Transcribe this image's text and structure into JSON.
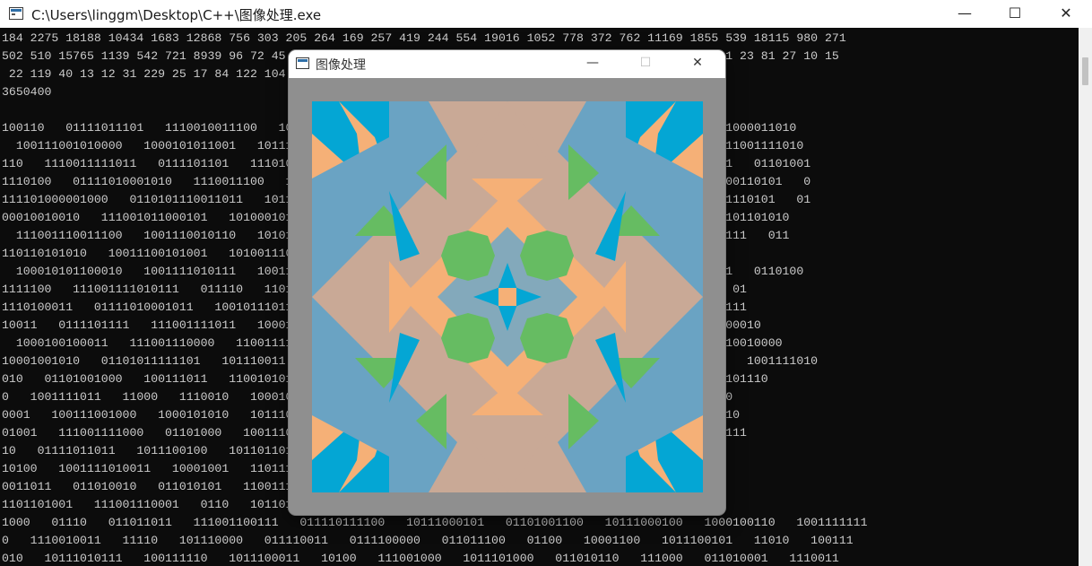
{
  "console": {
    "title": "C:\\Users\\linggm\\Desktop\\C++\\图像处理.exe",
    "controls": {
      "minimize": "—",
      "maximize": "☐",
      "close": "✕"
    },
    "lines": [
      "184 2275 18188 10434 1683 12868 756 303 205 264 169 257 419 244 554 19016 1052 778 372 762 11169 1855 539 18115 980 271",
      "502 510 15765 1139 542 721 8939 96 72 45 23 12 12 10 11 9 13 14 25 19 29 43 76 34 92 12 14 18 9 11 9 11 23 81 27 10 15",
      " 22 119 40 13 12 31 229 25 17 84 122 104 130 109 126 104 132 175 100 137 159 50 3740 903",
      "3650400",
      "",
      "100110   01111011101   1110010011100   1011101100   110010110011   101110000   0110101111110010   01101000011010",
      "  100111001010000   1000101011001   10111001   1110101011011   10011101   1110010   01101000011011   111001111010",
      "110   1110011111011   0111101101   1110101011   1001100101   0101110011   111110011   11100101111110011   01101001",
      "1110100   01111010001010   1110011100   11101011   1110100011   11101010   0   10001001110011   10011100110101   0",
      "111101000001000   0110101110011011   101110   11101000110   1011111001   10   01101001111001   01101001110101   01",
      "00010010010   111001011000101   1010001010   111011101   011110101   0001001   100010010011   10011110101101010",
      "  111001110011100   1001110010110   10101100   10101110101   1001100111   10001010110000   01101011111111   011",
      "110110101010   10011100101001   1010011100   101011100   010111010   0110101100111   10011100101010010",
      "  100010101100010   1001111010111   10011111   0101110101   1101001   1001011100   11   011110110101011   0110100",
      "1111100   111001111010111   011110   110101   1100101   011100111   10111010110000   111001011000100   01",
      "1110100011   01111010001011   10010111011   1110100   10011100111   101111010111   10001010111   11100111",
      "10011   0111101111   111001111011   100011100   0101010   1010   01001000   1001111010010   100010010000010",
      "  1000100100011   111001110000   11001111110   1001101101   1000101110   01   01101000011000   111001110010000",
      "10001001010   01101011111101   101110011   10110111   111100   100110111   1010110011   10001001111011   1001111010",
      "010   01101001000   100111011   11001010100   10101000101   010100   01101101010   100111111111   1000101110",
      "0   1001111011   11000   1110010   1000101000   1011101   1100   111001011110   11100101101   110011010",
      "0001   100111001000   1000101010   10111011   11000101   11010   1001110   100000   0110101001   1110010",
      "01001   111001111000   01101000   1001110   10111100   1000111   10001001011   011110100110   10011111111",
      "10   01111011011   1011100100   1011011010   1111000   11011   100111100000   111001011111   0111101",
      "10100   1001111010011   10001001   1101110   1011011   11010   000   01101000010   01101111   00   111",
      "0011011   011010010   011010101   1100111   1000110   0110   1110001   11100111111   11100101110   0",
      "1101101001   111001110001   0110   101101   111101   011   0101   10111011   11011   01000   1000",
      "1000   01110   011011011   111001100111   011110111100   10111000101   01101001100   10111000100   1000100110   1001111111",
      "0   1110010011   11110   101110000   011110011   0111100000   011011100   01100   10001100   1011100101   11010   100111",
      "010   10111010111   100111110   1011100011   10100   111001000   1011101000   011010110   111000   011010001   1110011"
    ]
  },
  "image_window": {
    "title": "图像处理",
    "controls": {
      "minimize": "—",
      "maximize": "☐",
      "close": "✕"
    },
    "colors": {
      "frame": "#8f8f8f",
      "steel_blue": "#6aa3c3",
      "cyan": "#04a6d4",
      "orange": "#f5b077",
      "tan": "#c9a996",
      "green": "#66bc62",
      "light_steel": "#83a9bb"
    }
  }
}
